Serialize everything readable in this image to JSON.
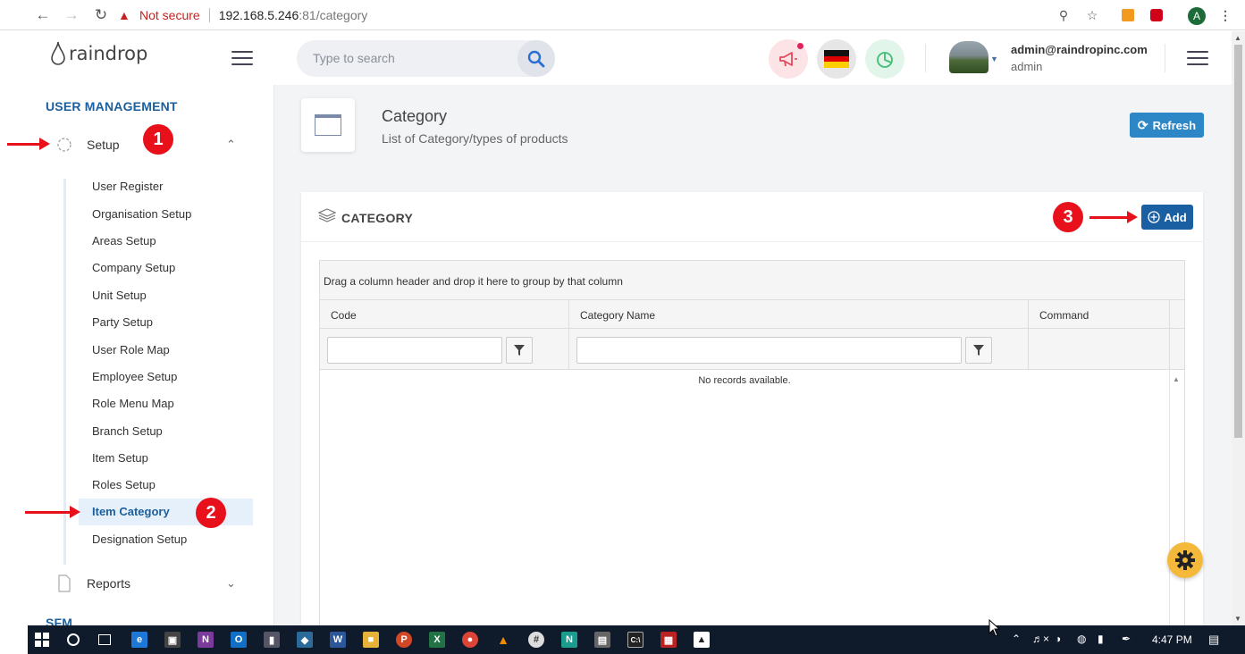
{
  "browser": {
    "warning": "Not secure",
    "url_host": "192.168.5.246",
    "url_path": ":81/category"
  },
  "topbar": {
    "logo": "raindrop",
    "search_placeholder": "Type to search",
    "user_email": "admin@raindropinc.com",
    "user_role": "admin"
  },
  "sidebar": {
    "section_title": "USER MANAGEMENT",
    "setup_label": "Setup",
    "items": [
      "User Register",
      "Organisation Setup",
      "Areas Setup",
      "Company Setup",
      "Unit Setup",
      "Party Setup",
      "User Role Map",
      "Employee Setup",
      "Role Menu Map",
      "Branch Setup",
      "Item Setup",
      "Roles Setup",
      "Item Category",
      "Designation Setup"
    ],
    "active_item": "Item Category",
    "reports_label": "Reports",
    "next_section": "SFM"
  },
  "page": {
    "title": "Category",
    "subtitle": "List of Category/types of products",
    "refresh_label": "Refresh"
  },
  "card": {
    "title": "CATEGORY",
    "add_label": "Add",
    "group_hint": "Drag a column header and drop it here to group by that column",
    "columns": [
      "Code",
      "Category Name",
      "Command"
    ],
    "empty_text": "No records available."
  },
  "annotations": [
    "1",
    "2",
    "3"
  ],
  "taskbar": {
    "time": "4:47 PM"
  },
  "colors": {
    "accent": "#1b5fa3",
    "refresh": "#2d87c6",
    "annotation": "#e8101a",
    "fab": "#f4b83a"
  }
}
